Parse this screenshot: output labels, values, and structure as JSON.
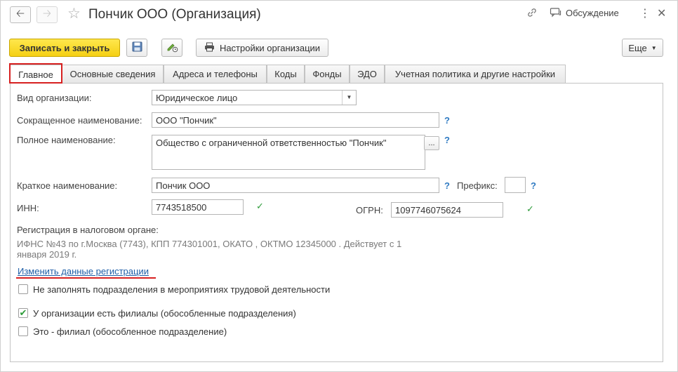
{
  "window": {
    "title": "Пончик ООО (Организация)",
    "discuss_label": "Обсуждение"
  },
  "toolbar": {
    "save_close_label": "Записать и закрыть",
    "org_settings_label": "Настройки организации",
    "more_label": "Еще"
  },
  "tabs": [
    {
      "label": "Главное",
      "active": true
    },
    {
      "label": "Основные сведения"
    },
    {
      "label": "Адреса и телефоны"
    },
    {
      "label": "Коды"
    },
    {
      "label": "Фонды"
    },
    {
      "label": "ЭДО"
    },
    {
      "label": "Учетная политика и другие настройки"
    }
  ],
  "form": {
    "org_type": {
      "label": "Вид организации:",
      "value": "Юридическое лицо"
    },
    "short_name": {
      "label": "Сокращенное наименование:",
      "value": "ООО \"Пончик\""
    },
    "full_name": {
      "label": "Полное наименование:",
      "value": "Общество с ограниченной ответственностью \"Пончик\""
    },
    "brief_name": {
      "label": "Краткое наименование:",
      "value": "Пончик ООО"
    },
    "prefix": {
      "label": "Префикс:",
      "value": ""
    },
    "inn": {
      "label": "ИНН:",
      "value": "7743518500"
    },
    "ogrn": {
      "label": "ОГРН:",
      "value": "1097746075624"
    },
    "help_mark": "?",
    "ellipsis": "...",
    "registration": {
      "label": "Регистрация в налоговом органе:",
      "line1": "ИФНС №43 по г.Москва (7743), КПП 774301001, ОКАТО , ОКТМО 12345000  . Действует с 1",
      "line2": "января 2019 г.",
      "change_link": "Изменить данные регистрации"
    },
    "checkboxes": [
      {
        "label": "Не заполнять подразделения в мероприятиях трудовой деятельности",
        "checked": false
      },
      {
        "label": "У организации есть филиалы (обособленные подразделения)",
        "checked": true
      },
      {
        "label": "Это - филиал (обособленное подразделение)",
        "checked": false
      }
    ]
  },
  "colors": {
    "accent_yellow": "#f5d014",
    "highlight_red": "#d72020",
    "help_blue": "#2f7ac2",
    "ok_green": "#2e9c3a"
  },
  "icons": [
    "back-arrow-icon",
    "forward-arrow-icon",
    "star-icon",
    "link-icon",
    "chat-icon",
    "more-vert-icon",
    "close-icon",
    "floppy-disk-icon",
    "edit-clock-icon",
    "printer-icon",
    "dropdown-arrow-icon",
    "checkmark-icon"
  ]
}
